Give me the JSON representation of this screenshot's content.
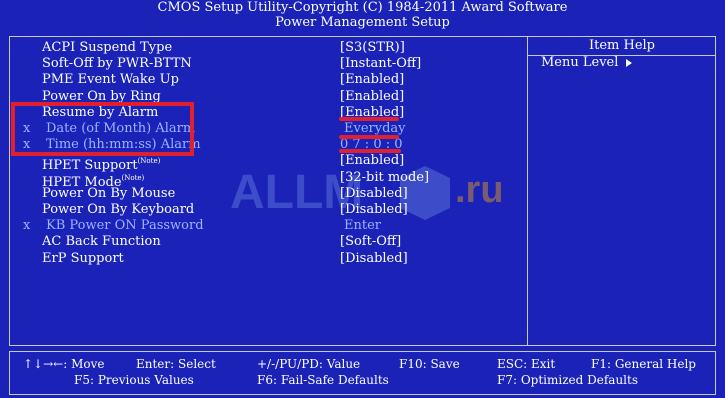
{
  "header": {
    "line1": "CMOS Setup Utility-Copyright (C) 1984-2011 Award Software",
    "line2": "Power Management Setup"
  },
  "help": {
    "title": "Item Help",
    "menu_level": "Menu Level"
  },
  "settings": [
    {
      "mark": "",
      "label": "ACPI Suspend Type",
      "sup": "",
      "value": "[S3(STR)]",
      "disabled": false
    },
    {
      "mark": "",
      "label": "Soft-Off by PWR-BTTN",
      "sup": "",
      "value": "[Instant-Off]",
      "disabled": false
    },
    {
      "mark": "",
      "label": "PME Event Wake Up",
      "sup": "",
      "value": "[Enabled]",
      "disabled": false
    },
    {
      "mark": "",
      "label": "Power On by Ring",
      "sup": "",
      "value": "[Enabled]",
      "disabled": false
    },
    {
      "mark": "",
      "label": "Resume by Alarm",
      "sup": "",
      "value": "[Enabled]",
      "disabled": false
    },
    {
      "mark": "x",
      "label": "Date (of Month) Alarm",
      "sup": "",
      "value": "Everyday",
      "disabled": true
    },
    {
      "mark": "x",
      "label": "Time (hh:mm:ss) Alarm",
      "sup": "",
      "value": "0 7 : 0 : 0",
      "disabled": true
    },
    {
      "mark": "",
      "label": "HPET Support",
      "sup": "(Note)",
      "value": "[Enabled]",
      "disabled": false
    },
    {
      "mark": "",
      "label": "HPET Mode",
      "sup": "(Note)",
      "value": "[32-bit mode]",
      "disabled": false
    },
    {
      "mark": "",
      "label": "Power On By Mouse",
      "sup": "",
      "value": "[Disabled]",
      "disabled": false
    },
    {
      "mark": "",
      "label": "Power On By Keyboard",
      "sup": "",
      "value": "[Disabled]",
      "disabled": false
    },
    {
      "mark": "x",
      "label": "KB Power ON Password",
      "sup": "",
      "value": "Enter",
      "disabled": true
    },
    {
      "mark": "",
      "label": "AC Back Function",
      "sup": "",
      "value": "[Soft-Off]",
      "disabled": false
    },
    {
      "mark": "",
      "label": "ErP Support",
      "sup": "",
      "value": "[Disabled]",
      "disabled": false
    }
  ],
  "footer": {
    "move": "↑↓→←: Move",
    "enter": "Enter: Select",
    "value": "+/-/PU/PD: Value",
    "save": "F10: Save",
    "exit": "ESC: Exit",
    "help": "F1: General Help",
    "prev": "F5: Previous Values",
    "failsafe": "F6: Fail-Safe Defaults",
    "optimized": "F7: Optimized Defaults"
  },
  "watermark": {
    "text": "ALLM",
    "suffix": ".ru"
  },
  "colors": {
    "background": "#1a22b8",
    "text": "#ffffff",
    "disabled_text": "#9ab4ff",
    "annotation": "#e0202e"
  }
}
